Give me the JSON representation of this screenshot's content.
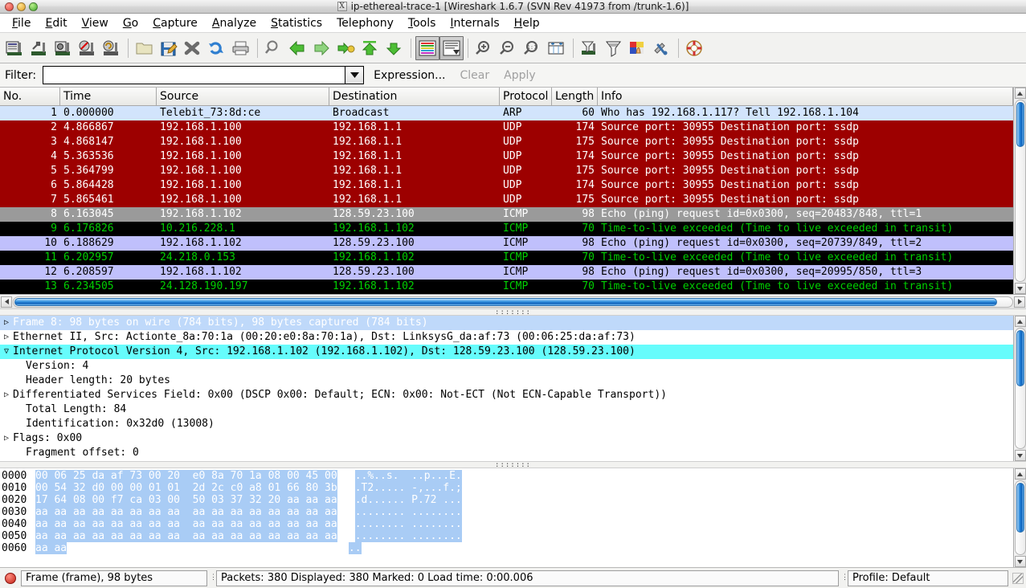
{
  "window": {
    "title": "ip-ethereal-trace-1   [Wireshark 1.6.7  (SVN Rev 41973 from /trunk-1.6)]",
    "icon": "x-window-icon"
  },
  "menu": [
    {
      "label": "File",
      "accel": "F"
    },
    {
      "label": "Edit",
      "accel": "E"
    },
    {
      "label": "View",
      "accel": "V"
    },
    {
      "label": "Go",
      "accel": "G"
    },
    {
      "label": "Capture",
      "accel": "C"
    },
    {
      "label": "Analyze",
      "accel": "A"
    },
    {
      "label": "Statistics",
      "accel": "S"
    },
    {
      "label": "Telephony",
      "accel": ""
    },
    {
      "label": "Tools",
      "accel": "T"
    },
    {
      "label": "Internals",
      "accel": "I"
    },
    {
      "label": "Help",
      "accel": "H"
    }
  ],
  "toolbar": [
    {
      "name": "list-interfaces-icon",
      "tip": "List the available capture interfaces"
    },
    {
      "name": "capture-options-icon",
      "tip": "Show the capture options"
    },
    {
      "name": "start-capture-icon",
      "tip": "Start a new live capture"
    },
    {
      "name": "stop-capture-icon",
      "tip": "Stop the running live capture"
    },
    {
      "name": "restart-capture-icon",
      "tip": "Restart the running live capture"
    },
    {
      "name": "open-file-icon",
      "tip": "Open a capture file"
    },
    {
      "name": "save-file-icon",
      "tip": "Save this capture file"
    },
    {
      "name": "close-file-icon",
      "tip": "Close this capture file"
    },
    {
      "name": "reload-file-icon",
      "tip": "Reload this capture file"
    },
    {
      "name": "print-icon",
      "tip": "Print packets"
    },
    {
      "name": "find-packet-icon",
      "tip": "Find a packet"
    },
    {
      "name": "go-back-icon",
      "tip": "Go back in packet history"
    },
    {
      "name": "go-forward-icon",
      "tip": "Go forward in packet history"
    },
    {
      "name": "go-to-packet-icon",
      "tip": "Go to a specific packet"
    },
    {
      "name": "go-first-packet-icon",
      "tip": "Go to the first packet"
    },
    {
      "name": "go-last-packet-icon",
      "tip": "Go to the last packet"
    },
    {
      "name": "colorize-icon",
      "tip": "Colorize packet list",
      "pressed": true
    },
    {
      "name": "auto-scroll-icon",
      "tip": "Auto scroll in live capture",
      "pressed": true
    },
    {
      "name": "zoom-in-icon",
      "tip": "Zoom in"
    },
    {
      "name": "zoom-out-icon",
      "tip": "Zoom out"
    },
    {
      "name": "zoom-normal-icon",
      "tip": "Normal size"
    },
    {
      "name": "resize-columns-icon",
      "tip": "Resize columns"
    },
    {
      "name": "capture-filter-icon",
      "tip": "Edit capture filters"
    },
    {
      "name": "display-filter-icon",
      "tip": "Edit display filters"
    },
    {
      "name": "coloring-rules-icon",
      "tip": "Edit coloring rules"
    },
    {
      "name": "preferences-icon",
      "tip": "Edit preferences"
    },
    {
      "name": "help-icon",
      "tip": "Show help"
    }
  ],
  "filter": {
    "label": "Filter:",
    "value": "",
    "placeholder": "",
    "expression_label": "Expression...",
    "clear_label": "Clear",
    "apply_label": "Apply"
  },
  "packet_list": {
    "columns": [
      "No.",
      "Time",
      "Source",
      "Destination",
      "Protocol",
      "Length",
      "Info"
    ],
    "rows": [
      {
        "no": "1",
        "time": "0.000000",
        "src": "Telebit_73:8d:ce",
        "dst": "Broadcast",
        "proto": "ARP",
        "len": "60",
        "info": "Who has 192.168.1.117?  Tell 192.168.1.104",
        "style": "arp"
      },
      {
        "no": "2",
        "time": "4.866867",
        "src": "192.168.1.100",
        "dst": "192.168.1.1",
        "proto": "UDP",
        "len": "174",
        "info": "Source port: 30955  Destination port: ssdp",
        "style": "udp"
      },
      {
        "no": "3",
        "time": "4.868147",
        "src": "192.168.1.100",
        "dst": "192.168.1.1",
        "proto": "UDP",
        "len": "175",
        "info": "Source port: 30955  Destination port: ssdp",
        "style": "udp"
      },
      {
        "no": "4",
        "time": "5.363536",
        "src": "192.168.1.100",
        "dst": "192.168.1.1",
        "proto": "UDP",
        "len": "174",
        "info": "Source port: 30955  Destination port: ssdp",
        "style": "udp"
      },
      {
        "no": "5",
        "time": "5.364799",
        "src": "192.168.1.100",
        "dst": "192.168.1.1",
        "proto": "UDP",
        "len": "175",
        "info": "Source port: 30955  Destination port: ssdp",
        "style": "udp"
      },
      {
        "no": "6",
        "time": "5.864428",
        "src": "192.168.1.100",
        "dst": "192.168.1.1",
        "proto": "UDP",
        "len": "174",
        "info": "Source port: 30955  Destination port: ssdp",
        "style": "udp"
      },
      {
        "no": "7",
        "time": "5.865461",
        "src": "192.168.1.100",
        "dst": "192.168.1.1",
        "proto": "UDP",
        "len": "175",
        "info": "Source port: 30955  Destination port: ssdp",
        "style": "udp"
      },
      {
        "no": "8",
        "time": "6.163045",
        "src": "192.168.1.102",
        "dst": "128.59.23.100",
        "proto": "ICMP",
        "len": "98",
        "info": "Echo (ping) request  id=0x0300, seq=20483/848, ttl=1",
        "style": "selected"
      },
      {
        "no": "9",
        "time": "6.176826",
        "src": "10.216.228.1",
        "dst": "192.168.1.102",
        "proto": "ICMP",
        "len": "70",
        "info": "Time-to-live exceeded (Time to live exceeded in transit)",
        "style": "icmp-err"
      },
      {
        "no": "10",
        "time": "6.188629",
        "src": "192.168.1.102",
        "dst": "128.59.23.100",
        "proto": "ICMP",
        "len": "98",
        "info": "Echo (ping) request  id=0x0300, seq=20739/849, ttl=2",
        "style": "icmp-req"
      },
      {
        "no": "11",
        "time": "6.202957",
        "src": "24.218.0.153",
        "dst": "192.168.1.102",
        "proto": "ICMP",
        "len": "70",
        "info": "Time-to-live exceeded (Time to live exceeded in transit)",
        "style": "icmp-err"
      },
      {
        "no": "12",
        "time": "6.208597",
        "src": "192.168.1.102",
        "dst": "128.59.23.100",
        "proto": "ICMP",
        "len": "98",
        "info": "Echo (ping) request  id=0x0300, seq=20995/850, ttl=3",
        "style": "icmp-req"
      },
      {
        "no": "13",
        "time": "6.234505",
        "src": "24.128.190.197",
        "dst": "192.168.1.102",
        "proto": "ICMP",
        "len": "70",
        "info": "Time-to-live exceeded (Time to live exceeded in transit)",
        "style": "icmp-err"
      }
    ]
  },
  "packet_detail": {
    "rows": [
      {
        "toggle": "collapsed",
        "indent": 0,
        "text": "Frame 8: 98 bytes on wire (784 bits), 98 bytes captured (784 bits)",
        "style": "frame-sel"
      },
      {
        "toggle": "collapsed",
        "indent": 0,
        "text": "Ethernet II, Src: Actionte_8a:70:1a (00:20:e0:8a:70:1a), Dst: LinksysG_da:af:73 (00:06:25:da:af:73)",
        "style": "normal"
      },
      {
        "toggle": "expanded",
        "indent": 0,
        "text": "Internet Protocol Version 4, Src: 192.168.1.102 (192.168.1.102), Dst: 128.59.23.100 (128.59.23.100)",
        "style": "highlight"
      },
      {
        "toggle": "none",
        "indent": 1,
        "text": "Version: 4",
        "style": "normal"
      },
      {
        "toggle": "none",
        "indent": 1,
        "text": "Header length: 20 bytes",
        "style": "normal"
      },
      {
        "toggle": "collapsed",
        "indent": 0,
        "text": "Differentiated Services Field: 0x00 (DSCP 0x00: Default; ECN: 0x00: Not-ECT (Not ECN-Capable Transport))",
        "style": "normal"
      },
      {
        "toggle": "none",
        "indent": 1,
        "text": "Total Length: 84",
        "style": "normal"
      },
      {
        "toggle": "none",
        "indent": 1,
        "text": "Identification: 0x32d0 (13008)",
        "style": "normal"
      },
      {
        "toggle": "collapsed",
        "indent": 0,
        "text": "Flags: 0x00",
        "style": "normal"
      },
      {
        "toggle": "none",
        "indent": 1,
        "text": "Fragment offset: 0",
        "style": "normal"
      }
    ]
  },
  "packet_bytes": {
    "rows": [
      {
        "offset": "0000",
        "hex": "00 06 25 da af 73 00 20  e0 8a 70 1a 08 00 45 00",
        "ascii": "..%..s.  ..p...E."
      },
      {
        "offset": "0010",
        "hex": "00 54 32 d0 00 00 01 01  2d 2c c0 a8 01 66 80 3b",
        "ascii": ".T2..... -,...f.;"
      },
      {
        "offset": "0020",
        "hex": "17 64 08 00 f7 ca 03 00  50 03 37 32 20 aa aa aa",
        "ascii": ".d...... P.72 ..."
      },
      {
        "offset": "0030",
        "hex": "aa aa aa aa aa aa aa aa  aa aa aa aa aa aa aa aa",
        "ascii": "........ ........"
      },
      {
        "offset": "0040",
        "hex": "aa aa aa aa aa aa aa aa  aa aa aa aa aa aa aa aa",
        "ascii": "........ ........"
      },
      {
        "offset": "0050",
        "hex": "aa aa aa aa aa aa aa aa  aa aa aa aa aa aa aa aa",
        "ascii": "........ ........"
      },
      {
        "offset": "0060",
        "hex": "aa aa",
        "ascii": ".."
      }
    ]
  },
  "statusbar": {
    "expert_info": "expert-info-led",
    "field_info": "Frame (frame), 98 bytes",
    "capture_info": "Packets: 380 Displayed: 380 Marked: 0 Load time: 0:00.006",
    "profile": "Profile: Default"
  },
  "colors": {
    "arp_bg": "#d2e4fc",
    "arp_fg": "#000000",
    "udp_bg": "#9d0000",
    "udp_fg": "#ffffff",
    "selected_bg": "#9a9a9a",
    "selected_fg": "#ffffff",
    "icmp_err_bg": "#000000",
    "icmp_err_fg": "#00d000",
    "icmp_req_bg": "#c0c0fc",
    "icmp_req_fg": "#000000",
    "detail_highlight": "#66fcfc",
    "detail_frame_sel": "#bfd9fa",
    "hex_selection": "#a9ccf5"
  }
}
